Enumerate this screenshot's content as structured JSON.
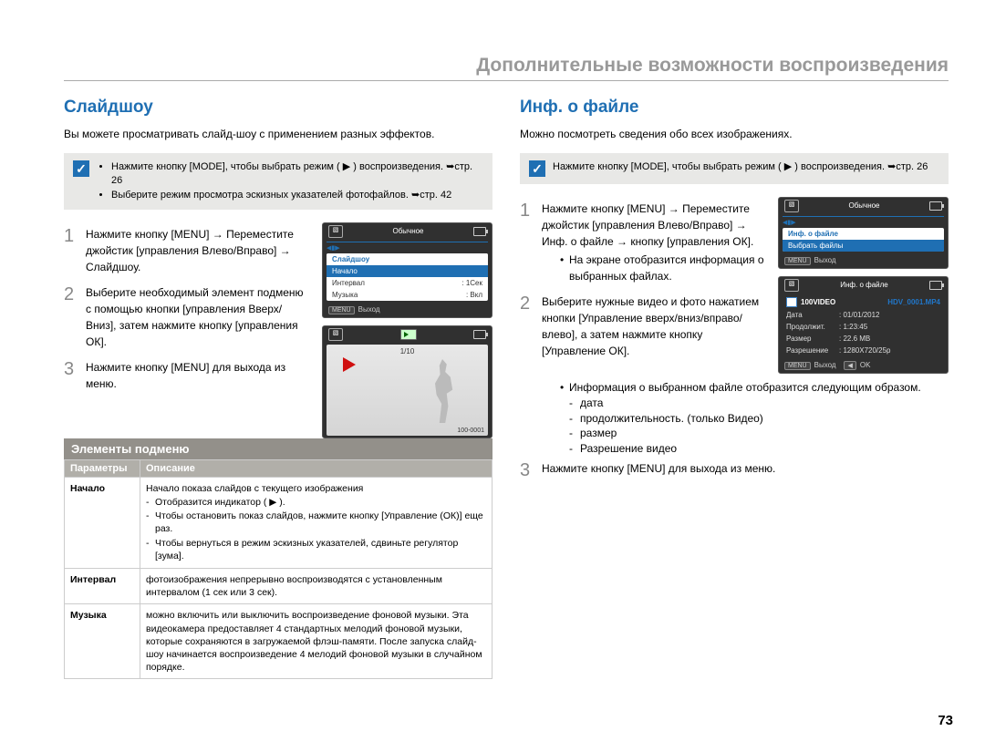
{
  "header": "Дополнительные возможности воспроизведения",
  "left": {
    "title": "Слайдшоу",
    "intro": "Вы можете просматривать слайд-шоу с применением разных эффектов.",
    "note_items": [
      "Нажмите кнопку [MODE], чтобы выбрать режим ( ▶ ) воспроизведения. ➥стр. 26",
      "Выберите режим просмотра эскизных указателей фотофайлов. ➥стр. 42"
    ],
    "step1": "Нажмите кнопку [MENU] → Переместите джойстик [управления Влево/Вправо] → Слайдшоу.",
    "step2": "Выберите необходимый элемент подменю с помощью кнопки [управления Вверх/Вниз], затем нажмите кнопку [управления ОК].",
    "step3": "Нажмите кнопку [MENU] для выхода из меню.",
    "submenu_head": "Элементы подменю",
    "table_head_param": "Параметры",
    "table_head_desc": "Описание",
    "row1_param": "Начало",
    "row1_desc_line1": "Начало показа слайдов с текущего изображения",
    "row1_desc_li1": "Отобразится индикатор ( ▶ ).",
    "row1_desc_li2": "Чтобы остановить показ слайдов, нажмите кнопку [Управление (ОК)] еще раз.",
    "row1_desc_li3": "Чтобы вернуться в режим эскизных указателей, сдвиньте регулятор [зума].",
    "row2_param": "Интервал",
    "row2_desc": "фотоизображения непрерывно воспроизводятся с установленным интервалом (1 сек или 3 сек).",
    "row3_param": "Музыка",
    "row3_desc": "можно включить или выключить воспроизведение фоновой музыки. Эта видеокамера предоставляет 4 стандартных мелодий фоновой музыки, которые сохраняются в загружаемой флэш-памяти. После запуска слайд-шоу начинается воспроизведение 4 мелодий фоновой музыки в случайном порядке.",
    "screen1": {
      "mode_label": "Обычное",
      "item_sel": "Слайдшоу",
      "item_start": "Начало",
      "item_interval_k": "Интервал",
      "item_interval_v": ": 1Сек",
      "item_music_k": "Музыка",
      "item_music_v": ": Вкл",
      "exit": "Выход",
      "menu_tag": "MENU"
    },
    "screen2": {
      "counter": "1/10",
      "fileid": "100-0001"
    }
  },
  "right": {
    "title": "Инф. о файле",
    "intro": "Можно посмотреть сведения обо всех изображениях.",
    "note": "Нажмите кнопку [MODE], чтобы выбрать режим ( ▶ ) воспроизведения. ➥стр. 26",
    "step1": "Нажмите кнопку [MENU] → Переместите джойстик [управления Влево/Вправо] → Инф. о файле → кнопку [управления ОК].",
    "step1_sub": "На экране отобразится информация о выбранных файлах.",
    "step2_a": "Выберите нужные видео и фото нажатием кнопки [Управление вверх/вниз/вправо/влево], а затем нажмите кнопку [Управление ОК].",
    "step2_sub_intro": "Информация о выбранном файле отобразится следующим образом.",
    "step2_sub_list": [
      "дата",
      "продолжительность. (только Видео)",
      "размер",
      "Разрешение видео"
    ],
    "step3": "Нажмите кнопку [MENU] для выхода из меню.",
    "screen1": {
      "mode_label": "Обычное",
      "item_info": "Инф. о файле",
      "item_sel": "Выбрать файлы",
      "exit": "Выход",
      "menu_tag": "MENU"
    },
    "screen2": {
      "panel_title": "Инф. о файле",
      "folder": "100VIDEO",
      "filename": "HDV_0001.MP4",
      "date_k": "Дата",
      "date_v": ": 01/01/2012",
      "dur_k": "Продолжит.",
      "dur_v": ": 1:23:45",
      "size_k": "Размер",
      "size_v": ": 22.6 MB",
      "res_k": "Разрешение",
      "res_v": ": 1280X720/25p",
      "exit": "Выход",
      "ok": "OK",
      "menu_tag": "MENU",
      "back_tag": "◀"
    }
  },
  "page_number": "73"
}
